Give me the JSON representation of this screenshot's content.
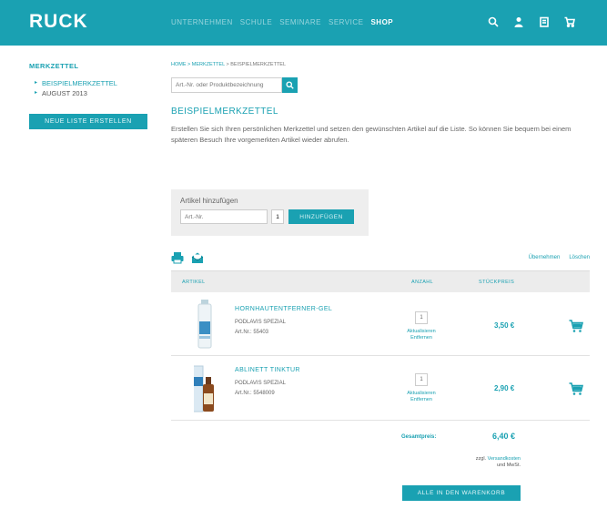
{
  "header": {
    "logo": "RUCK",
    "nav": [
      "Unternehmen",
      "Schule",
      "Seminare",
      "Service",
      "Shop"
    ],
    "icons": [
      "search-icon",
      "user-icon",
      "notepad-icon",
      "cart-icon"
    ]
  },
  "sidebar": {
    "title": "Merkzettel",
    "items": [
      {
        "label": "Beispielmerkzettel",
        "active": true
      },
      {
        "label": "August 2013",
        "active": false
      }
    ],
    "new_list_button": "Neue Liste erstellen"
  },
  "main": {
    "breadcrumb": {
      "link": "Home > Merkzettel",
      "current": " > Beispielmerkzettel"
    },
    "search_placeholder": "Art.-Nr. oder Produktbezeichnung",
    "title": "Beispielmerkzettel",
    "intro": "Erstellen Sie sich Ihren persönlichen Merkzettel und setzen den gewünschten Artikel auf die Liste. So können Sie bequem bei einem späteren Besuch Ihre vorgemerkten Artikel wieder abrufen.",
    "add": {
      "label": "Artikel hinzufügen",
      "art_placeholder": "Art.-Nr.",
      "qty": "1",
      "button": "Hinzufügen"
    },
    "tools": {
      "links": [
        "Übernehmen",
        "Löschen"
      ]
    },
    "table": {
      "headers": {
        "article": "Artikel",
        "qty": "Anzahl",
        "price": "Stückpreis"
      },
      "rows": [
        {
          "name": "Hornhautentferner-Gel",
          "brand": "Podlavis Spezial",
          "art": "Art.Nr.: 55403",
          "qty": "1",
          "link": "Aktualisieren Entfernen",
          "price": "3,50 €"
        },
        {
          "name": "Ablinett Tinktur",
          "brand": "Podlavis Spezial",
          "art": "Art.Nr.: 5548009",
          "qty": "1",
          "link": "Aktualisieren Entfernen",
          "price": "2,90 €"
        }
      ]
    },
    "total": {
      "label": "Gesamtpreis:",
      "value": "6,40 €"
    },
    "shipping": {
      "prefix": "zzgl. ",
      "link": "Versandkosten",
      "suffix": " und MwSt."
    },
    "all_to_cart": "Alle in den Warenkorb"
  },
  "colors": {
    "accent": "#1aa1b2",
    "header_bg": "#1aa1b2",
    "panel_bg": "#eeeeee"
  }
}
